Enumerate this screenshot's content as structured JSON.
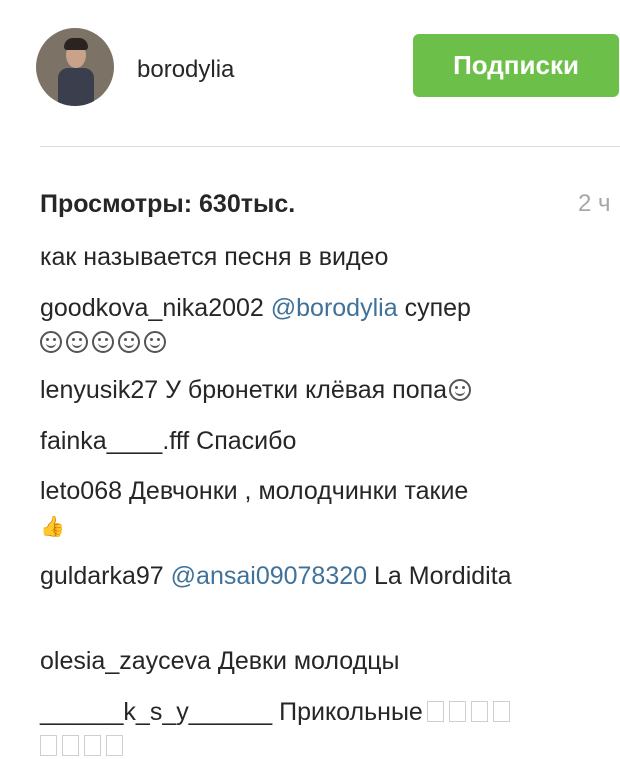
{
  "header": {
    "username": "borodylia",
    "follow_label": "Подписки",
    "follow_color": "#6cc04a"
  },
  "meta": {
    "views": "Просмотры: 630тыс.",
    "time": "2 ч"
  },
  "comments": [
    {
      "user": "",
      "text": "как называется песня в видео"
    },
    {
      "user": "goodkova_nika2002",
      "mention": "@borodylia",
      "text": "супер",
      "emoji_count": 5
    },
    {
      "user": "lenyusik27",
      "text": "У брюнетки клёвая попа"
    },
    {
      "user": "fainka____.fff",
      "text": "Спасибо"
    },
    {
      "user": "leto068",
      "text": "Девчонки , молодчинки такие"
    },
    {
      "user": "guldarka97",
      "mention": "@ansai09078320",
      "text": "La Mordidita"
    },
    {
      "user": "olesia_zayceva",
      "text": "Девки молодцы"
    },
    {
      "user": "______k_s_y______",
      "text": "Прикольные"
    }
  ],
  "icons": {
    "smiley": "smiley-emoji-icon",
    "thumb": "thumbs-up-emoji-icon",
    "missing_glyph": "missing-glyph-box-icon"
  }
}
